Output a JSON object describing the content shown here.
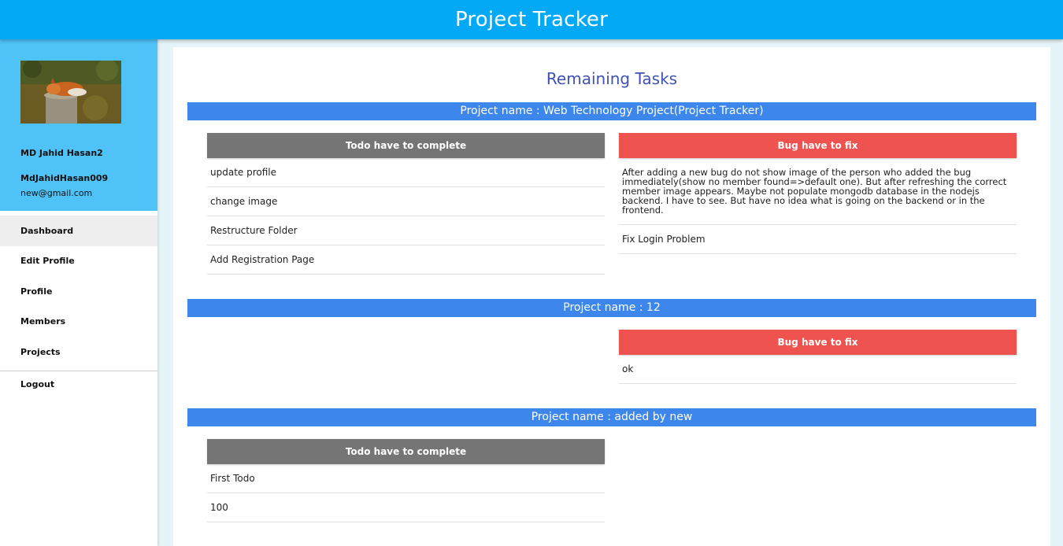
{
  "header": {
    "title": "Project Tracker"
  },
  "sidebar": {
    "name": "MD Jahid Hasan2",
    "username": "MdJahidHasan009",
    "email": "new@gmail.com",
    "nav": [
      "Dashboard",
      "Edit Profile",
      "Profile",
      "Members",
      "Projects"
    ],
    "logout": "Logout"
  },
  "main": {
    "title": "Remaining Tasks",
    "todo_header": "Todo have to complete",
    "bug_header": "Bug have to fix",
    "projects": [
      {
        "name": "Project name : Web Technology Project(Project Tracker)",
        "todos": [
          "update profile",
          "change image",
          "Restructure Folder",
          "Add Registration Page"
        ],
        "bugs": [
          "After adding a new bug do not show image of the person who added the bug immediately(show no member found=>default one). But after refreshing the correct member image appears. Maybe not populate mongodb database in the nodejs backend. I have to see. But have no idea what is going on the backend or in the frontend.",
          "Fix Login Problem"
        ]
      },
      {
        "name": "Project name : 12",
        "todos": [],
        "bugs": [
          "ok"
        ]
      },
      {
        "name": "Project name : added by new",
        "todos": [
          "First Todo",
          "100"
        ],
        "bugs": []
      }
    ]
  },
  "colors": {
    "topbar": "#03a9f4",
    "profile_bg": "#4fc3f7",
    "project_bar": "#3d87ec",
    "bug_header": "#ef5350",
    "todo_header": "#757575",
    "title": "#3f51b5"
  }
}
